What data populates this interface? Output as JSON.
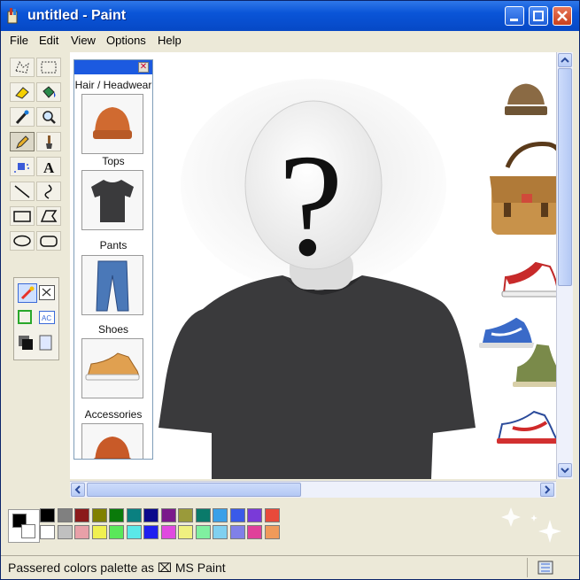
{
  "window": {
    "title": "untitled - Paint"
  },
  "menu": [
    "File",
    "Edit",
    "View",
    "Options",
    "Help"
  ],
  "tools": [
    "free-select",
    "rect-select",
    "eraser",
    "fill-bucket",
    "color-picker",
    "magnifier",
    "pencil",
    "brush",
    "airbrush",
    "text",
    "line",
    "curve",
    "rectangle",
    "polygon",
    "ellipse",
    "rounded-rectangle"
  ],
  "wardrobe_panel": {
    "categories": [
      {
        "label": "Hair / Headwear",
        "icon": "beanie-icon"
      },
      {
        "label": "Tops",
        "icon": "tshirt-icon"
      },
      {
        "label": "Pants",
        "icon": "jeans-icon"
      },
      {
        "label": "Shoes",
        "icon": "sneaker-icon"
      },
      {
        "label": "Accessories",
        "icon": "beanie-icon"
      }
    ]
  },
  "canvas": {
    "face_symbol": "?",
    "stickers": [
      "beanie-icon",
      "messenger-bag-icon",
      "red-sneaker-icon",
      "blue-sneaker-icon",
      "olive-hightop-icon",
      "white-red-sneaker-icon"
    ]
  },
  "palette": {
    "primary": "#000000",
    "secondary": "#ffffff",
    "row1": [
      "#000000",
      "#808080",
      "#8b1a1a",
      "#808000",
      "#0a7a0a",
      "#0a8080",
      "#0a0a8b",
      "#7a1a8b",
      "#9a9a3a",
      "#0a7a6a",
      "#3aa0e8",
      "#3a5ae8",
      "#7a3ad8",
      "#e84a3a"
    ],
    "row2": [
      "#ffffff",
      "#c0c0c0",
      "#e8a0a8",
      "#f0f050",
      "#5ae85a",
      "#5ae8e8",
      "#2020f0",
      "#e04ae0",
      "#f0f080",
      "#80f0a0",
      "#80d0f0",
      "#8080e8",
      "#e0409a",
      "#f09a5a"
    ]
  },
  "status": {
    "text": "Passered colors palette as ⌧ MS Paint"
  }
}
